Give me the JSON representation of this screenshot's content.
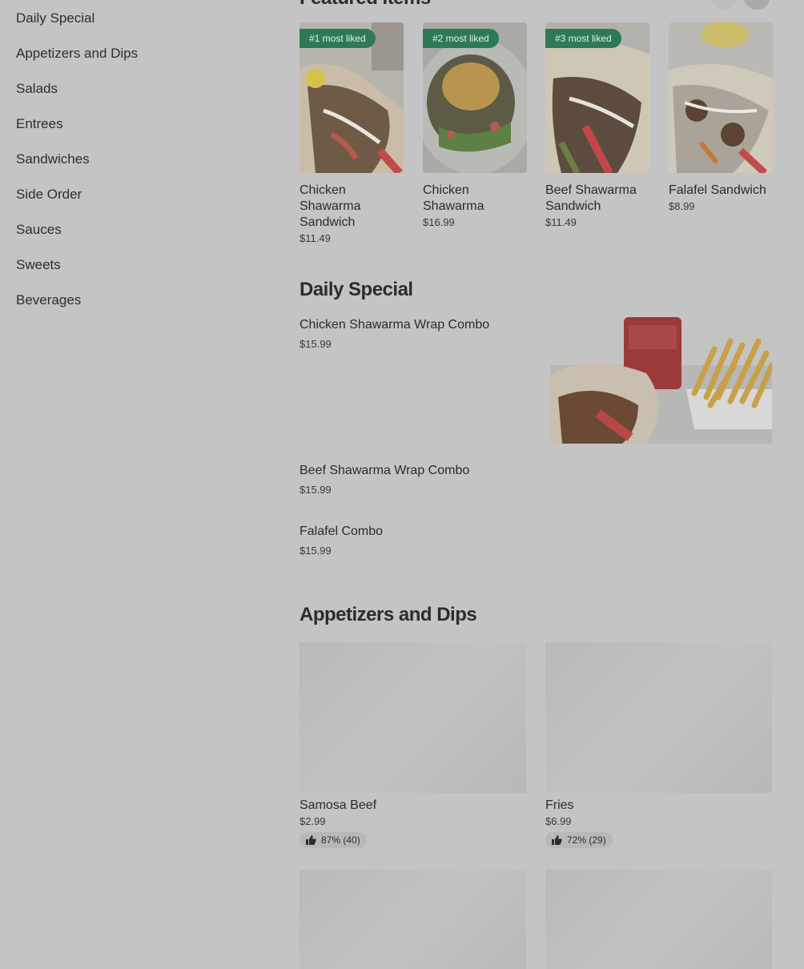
{
  "sidebar": {
    "items": [
      {
        "label": "Daily Special"
      },
      {
        "label": "Appetizers and Dips"
      },
      {
        "label": "Salads"
      },
      {
        "label": "Entrees"
      },
      {
        "label": "Sandwiches"
      },
      {
        "label": "Side Order"
      },
      {
        "label": "Sauces"
      },
      {
        "label": "Sweets"
      },
      {
        "label": "Beverages"
      }
    ]
  },
  "featured": {
    "title": "Featured Items",
    "items": [
      {
        "badge": "#1 most liked",
        "name": "Chicken Shawarma Sandwich",
        "price": "$11.49"
      },
      {
        "badge": "#2 most liked",
        "name": "Chicken Shawarma",
        "price": "$16.99"
      },
      {
        "badge": "#3 most liked",
        "name": "Beef Shawarma Sandwich",
        "price": "$11.49"
      },
      {
        "badge": "",
        "name": "Falafel Sandwich",
        "price": "$8.99"
      }
    ]
  },
  "daily_special": {
    "title": "Daily Special",
    "items": [
      {
        "name": "Chicken Shawarma Wrap Combo",
        "price": "$15.99"
      },
      {
        "name": "Beef Shawarma Wrap Combo",
        "price": "$15.99"
      },
      {
        "name": "Falafel Combo",
        "price": "$15.99"
      }
    ]
  },
  "appetizers": {
    "title": "Appetizers and Dips",
    "items": [
      {
        "name": "Samosa Beef",
        "price": "$2.99",
        "rating": "87% (40)"
      },
      {
        "name": "Fries",
        "price": "$6.99",
        "rating": "72% (29)"
      }
    ]
  }
}
